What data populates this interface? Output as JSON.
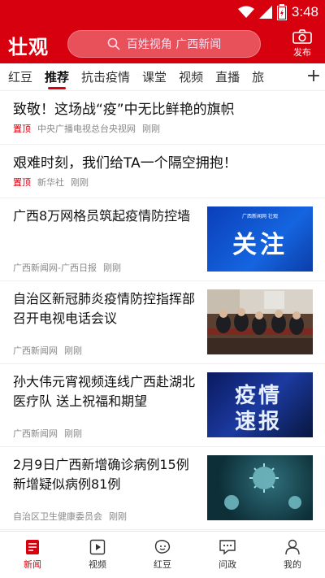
{
  "status": {
    "time": "3:48"
  },
  "header": {
    "logo": "壮观",
    "search_placeholder": "百姓视角 广西新闻",
    "publish_label": "发布"
  },
  "tabs": [
    "红豆",
    "推荐",
    "抗击疫情",
    "课堂",
    "视频",
    "直播",
    "旅"
  ],
  "active_tab": "推荐",
  "pinned": [
    {
      "title": "致敬！这场战“疫”中无比鲜艳的旗帜",
      "tag": "置顶",
      "source": "中央广播电视总台央视网",
      "time": "刚刚"
    },
    {
      "title": "艰难时刻，我们给TA一个隔空拥抱！",
      "tag": "置顶",
      "source": "新华社",
      "time": "刚刚"
    }
  ],
  "articles": [
    {
      "title": "广西8万网格员筑起疫情防控墙",
      "source": "广西新闻网-广西日报",
      "time": "刚刚",
      "thumb_text": "关注",
      "thumb_badge": "广西新闻网 壮观"
    },
    {
      "title": "自治区新冠肺炎疫情防控指挥部召开电视电话会议",
      "source": "广西新闻网",
      "time": "刚刚"
    },
    {
      "title": "孙大伟元宵视频连线广西赴湖北医疗队 送上祝福和期望",
      "source": "广西新闻网",
      "time": "刚刚",
      "thumb_text1": "疫情",
      "thumb_text2": "速报"
    },
    {
      "title": "2月9日广西新增确诊病例15例 新增疑似病例81例",
      "source": "自治区卫生健康委员会",
      "time": "刚刚"
    }
  ],
  "bottom_nav": [
    {
      "label": "新闻",
      "icon": "news-icon"
    },
    {
      "label": "视频",
      "icon": "video-icon"
    },
    {
      "label": "红豆",
      "icon": "hongdou-icon"
    },
    {
      "label": "问政",
      "icon": "chat-icon"
    },
    {
      "label": "我的",
      "icon": "profile-icon"
    }
  ],
  "colors": {
    "brand": "#d7000f"
  }
}
